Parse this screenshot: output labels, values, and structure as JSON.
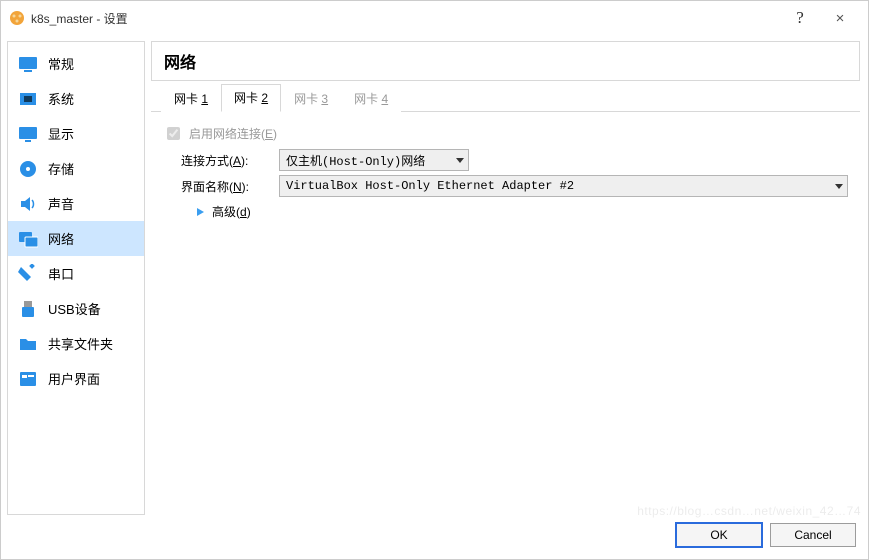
{
  "title": "k8s_master - 设置",
  "titlebar": {
    "help_symbol": "?",
    "close_symbol": "×"
  },
  "sidebar": {
    "items": [
      {
        "label": "常规",
        "icon": "general-icon"
      },
      {
        "label": "系统",
        "icon": "system-icon"
      },
      {
        "label": "显示",
        "icon": "display-icon"
      },
      {
        "label": "存储",
        "icon": "storage-icon"
      },
      {
        "label": "声音",
        "icon": "audio-icon"
      },
      {
        "label": "网络",
        "icon": "network-icon"
      },
      {
        "label": "串口",
        "icon": "serial-icon"
      },
      {
        "label": "USB设备",
        "icon": "usb-icon"
      },
      {
        "label": "共享文件夹",
        "icon": "shared-folder-icon"
      },
      {
        "label": "用户界面",
        "icon": "ui-icon"
      }
    ],
    "active_index": 5
  },
  "panel": {
    "title": "网络"
  },
  "tabs": {
    "labels": [
      "网卡 ",
      "网卡 ",
      "网卡 ",
      "网卡 "
    ],
    "numbers": [
      "1",
      "2",
      "3",
      "4"
    ],
    "active_index": 1,
    "enabled": [
      true,
      true,
      false,
      false
    ]
  },
  "form": {
    "enable_label": "启用网络连接(",
    "enable_hotkey": "E",
    "enable_suffix": ")",
    "enable_checked": true,
    "attach_label": "连接方式(",
    "attach_hotkey": "A",
    "attach_suffix": "):",
    "attach_value": "仅主机(Host-Only)网络",
    "iface_label": "界面名称(",
    "iface_hotkey": "N",
    "iface_suffix": "):",
    "iface_value": "VirtualBox Host-Only Ethernet Adapter #2",
    "adv_label": "高级(",
    "adv_hotkey": "d",
    "adv_suffix": ")"
  },
  "footer": {
    "ok": "OK",
    "cancel": "Cancel"
  },
  "watermark": "https://blog…csdn…net/weixin_42…74"
}
